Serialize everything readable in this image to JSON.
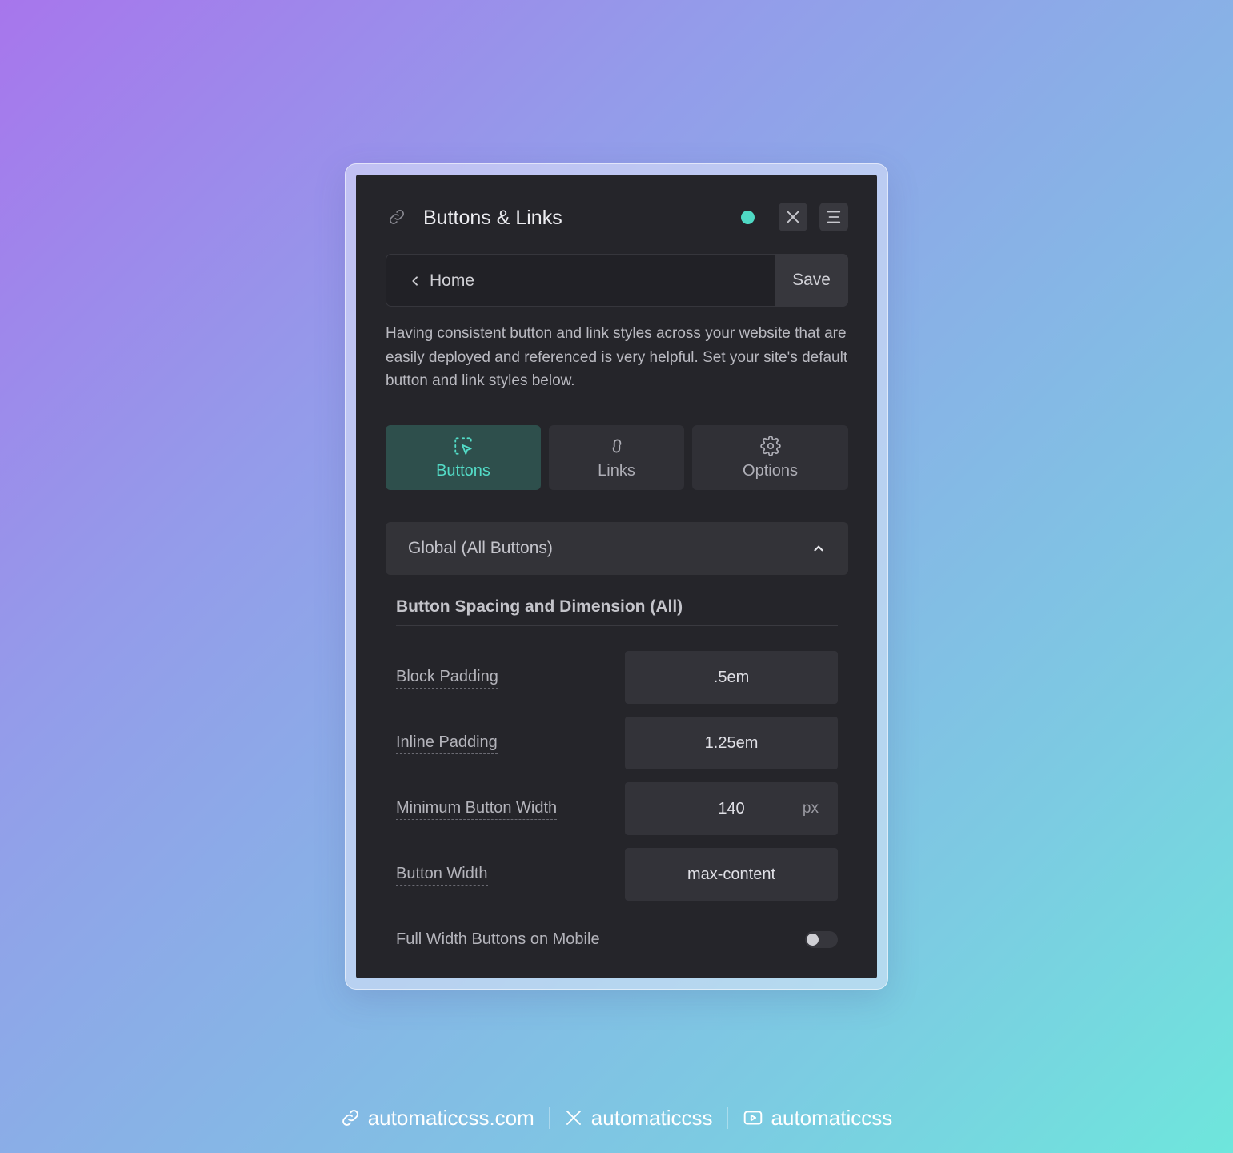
{
  "panel": {
    "title": "Buttons & Links",
    "title_icon": "link-icon",
    "status_color": "#4fd9c4",
    "close_icon": "close-icon",
    "menu_icon": "menu-icon"
  },
  "nav": {
    "back_label": "Home",
    "save_label": "Save"
  },
  "description": "Having consistent button and link styles across your website that are easily deployed and referenced is very helpful. Set your site's default button and link styles below.",
  "tabs": [
    {
      "label": "Buttons",
      "icon": "pointer-select-icon",
      "active": true
    },
    {
      "label": "Links",
      "icon": "link-icon",
      "active": false
    },
    {
      "label": "Options",
      "icon": "gear-icon",
      "active": false
    }
  ],
  "accordion": {
    "label": "Global (All Buttons)",
    "expanded": true
  },
  "section": {
    "title": "Button Spacing and Dimension (All)"
  },
  "fields": [
    {
      "label": "Block Padding",
      "value": ".5em",
      "unit": ""
    },
    {
      "label": "Inline Padding",
      "value": "1.25em",
      "unit": ""
    },
    {
      "label": "Minimum Button Width",
      "value": "140",
      "unit": "px"
    },
    {
      "label": "Button Width",
      "value": "max-content",
      "unit": ""
    }
  ],
  "toggle": {
    "label": "Full Width Buttons on Mobile",
    "on": false
  },
  "footer": {
    "website": "automaticcss.com",
    "x_handle": "automaticcss",
    "youtube_handle": "automaticcss"
  },
  "colors": {
    "accent": "#53dcc7",
    "panel_bg": "#25252a",
    "active_tab_bg": "#2e4f4c"
  }
}
